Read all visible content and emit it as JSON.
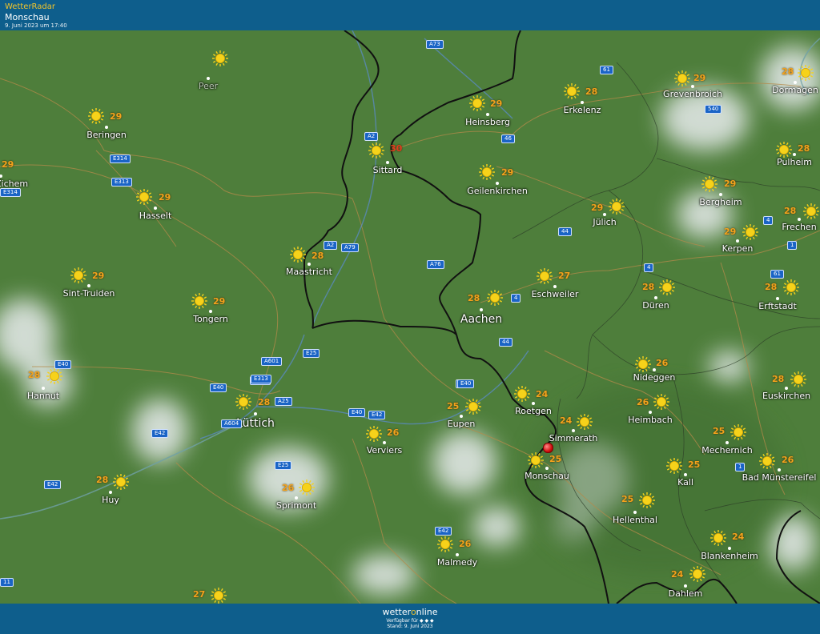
{
  "header": {
    "app_name": "WetterRadar",
    "location": "Monschau",
    "timestamp": "9. Juni 2023 um 17:40"
  },
  "footer": {
    "brand_left": "wetter",
    "brand_o": "o",
    "brand_right": "nline",
    "available": "Verfügbar für ◆ ◆ ◆",
    "stand": "Stand: 9. Juni 2023"
  },
  "colors": {
    "land": "#4e7e3b",
    "bar": "#0e5e8c",
    "temp": "#f4a21c",
    "temp_hot": "#e23b1f",
    "road_shield": "#1a64c6"
  },
  "cities": [
    {
      "name": "Peer",
      "temp": "",
      "dim": true
    },
    {
      "name": "Beringen",
      "temp": "29"
    },
    {
      "name": "avel-Zichem",
      "temp": "29"
    },
    {
      "name": "Hasselt",
      "temp": "29"
    },
    {
      "name": "Sittard",
      "temp": "30",
      "hot": true
    },
    {
      "name": "Heinsberg",
      "temp": "29"
    },
    {
      "name": "Erkelenz",
      "temp": "28"
    },
    {
      "name": "Grevenbroich",
      "temp": "29"
    },
    {
      "name": "Dormagen",
      "temp": "28"
    },
    {
      "name": "Pulheim",
      "temp": "28"
    },
    {
      "name": "Geilenkirchen",
      "temp": "29"
    },
    {
      "name": "Bergheim",
      "temp": "29"
    },
    {
      "name": "Jülich",
      "temp": "29"
    },
    {
      "name": "Frechen",
      "temp": "28"
    },
    {
      "name": "Kerpen",
      "temp": "29"
    },
    {
      "name": "Maastricht",
      "temp": "28"
    },
    {
      "name": "Sint-Truiden",
      "temp": "29"
    },
    {
      "name": "Tongern",
      "temp": "29"
    },
    {
      "name": "Aachen",
      "temp": "28",
      "big": true
    },
    {
      "name": "Eschweiler",
      "temp": "27"
    },
    {
      "name": "Düren",
      "temp": "28"
    },
    {
      "name": "Erftstadt",
      "temp": "28"
    },
    {
      "name": "Hannut",
      "temp": "28"
    },
    {
      "name": "Lüttich",
      "temp": "28",
      "big": true
    },
    {
      "name": "Nideggen",
      "temp": "26"
    },
    {
      "name": "Euskirchen",
      "temp": "28"
    },
    {
      "name": "Eupen",
      "temp": "25"
    },
    {
      "name": "Roetgen",
      "temp": "24"
    },
    {
      "name": "Heimbach",
      "temp": "26"
    },
    {
      "name": "Verviers",
      "temp": "26"
    },
    {
      "name": "Simmerath",
      "temp": "24"
    },
    {
      "name": "Mechernich",
      "temp": "25"
    },
    {
      "name": "Monschau",
      "temp": "25"
    },
    {
      "name": "Kall",
      "temp": "25"
    },
    {
      "name": "Bad Münstereifel",
      "temp": "26"
    },
    {
      "name": "Huy",
      "temp": "28"
    },
    {
      "name": "Sprimont",
      "temp": "26"
    },
    {
      "name": "Hellenthal",
      "temp": "25"
    },
    {
      "name": "Malmedy",
      "temp": "26"
    },
    {
      "name": "Blankenheim",
      "temp": "24"
    },
    {
      "name": "Dahlem",
      "temp": "24"
    },
    {
      "name": "",
      "temp": "27"
    }
  ],
  "roads": [
    "A73",
    "A2",
    "46",
    "61",
    "540",
    "E314",
    "E313",
    "E314",
    "A2",
    "A79",
    "A76",
    "4",
    "1",
    "61",
    "4",
    "4",
    "E313",
    "A601",
    "E25",
    "E40",
    "E313",
    "A25",
    "E40",
    "A604",
    "E40",
    "E42",
    "E42",
    "E25",
    "E42",
    "E40",
    "44",
    "44",
    "1",
    "E40",
    "E42",
    "11"
  ]
}
